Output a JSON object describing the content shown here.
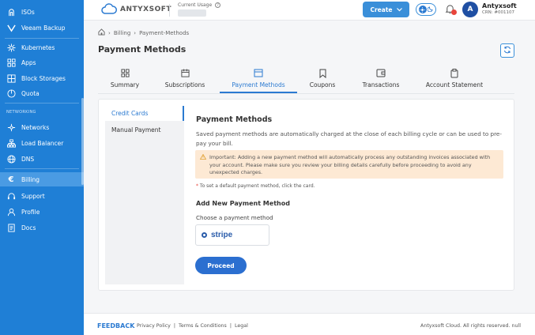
{
  "sidebar": {
    "items": [
      {
        "label": "ISOs",
        "icon": "iso-icon"
      },
      {
        "label": "Veeam Backup",
        "icon": "veeam-icon"
      },
      {
        "label": "Kubernetes",
        "icon": "kubernetes-icon"
      },
      {
        "label": "Apps",
        "icon": "apps-grid-icon"
      },
      {
        "label": "Block Storages",
        "icon": "storage-icon"
      },
      {
        "label": "Quota",
        "icon": "quota-icon"
      },
      {
        "label": "Networks",
        "icon": "network-icon"
      },
      {
        "label": "Load Balancer",
        "icon": "load-balancer-icon"
      },
      {
        "label": "DNS",
        "icon": "dns-globe-icon"
      },
      {
        "label": "Billing",
        "icon": "euro-icon"
      },
      {
        "label": "Support",
        "icon": "headset-icon"
      },
      {
        "label": "Profile",
        "icon": "user-icon"
      },
      {
        "label": "Docs",
        "icon": "document-icon"
      }
    ],
    "section_networking": "NETWORKING",
    "active": "Billing"
  },
  "header": {
    "logo_text": "ANTYXSOFT",
    "usage_label": "Current Usage",
    "create_label": "Create",
    "user_initial": "A",
    "user_name": "Antyxsoft",
    "user_crn": "CRN: #001107"
  },
  "breadcrumb": {
    "items": [
      "Billing",
      "Payment-Methods"
    ]
  },
  "page": {
    "title": "Payment Methods"
  },
  "tabs": [
    {
      "label": "Summary",
      "icon": "grid-icon"
    },
    {
      "label": "Subscriptions",
      "icon": "calendar-icon"
    },
    {
      "label": "Payment Methods",
      "icon": "card-icon"
    },
    {
      "label": "Coupons",
      "icon": "bookmark-icon"
    },
    {
      "label": "Transactions",
      "icon": "wallet-icon"
    },
    {
      "label": "Account Statement",
      "icon": "clipboard-icon"
    }
  ],
  "active_tab": "Payment Methods",
  "side_menu": {
    "items": [
      "Credit Cards",
      "Manual Payment"
    ],
    "active": "Credit Cards"
  },
  "content": {
    "title": "Payment Methods",
    "description": "Saved payment methods are automatically charged at the close of each billing cycle or can be used to pre-pay your bill.",
    "warning": "Important: Adding a new payment method will automatically process any outstanding invoices associated with your account. Please make sure you review your billing details carefully before proceeding to avoid any unexpected charges.",
    "note": "To set a default payment method, click the card.",
    "add_title": "Add New Payment Method",
    "choose_label": "Choose a payment method",
    "stripe_label": "stripe",
    "proceed_label": "Proceed"
  },
  "footer": {
    "feedback": "FEEDBACK",
    "links": [
      "Privacy Policy",
      "|",
      "Terms & Conditions",
      "|",
      "Legal"
    ],
    "copyright": "Antyxsoft Cloud. All rights reserved. null"
  },
  "colors": {
    "sidebar_bg": "#1f7fd6",
    "accent": "#2b7ad1",
    "warning_bg": "#fde9d4",
    "badge": "#e8453c"
  }
}
